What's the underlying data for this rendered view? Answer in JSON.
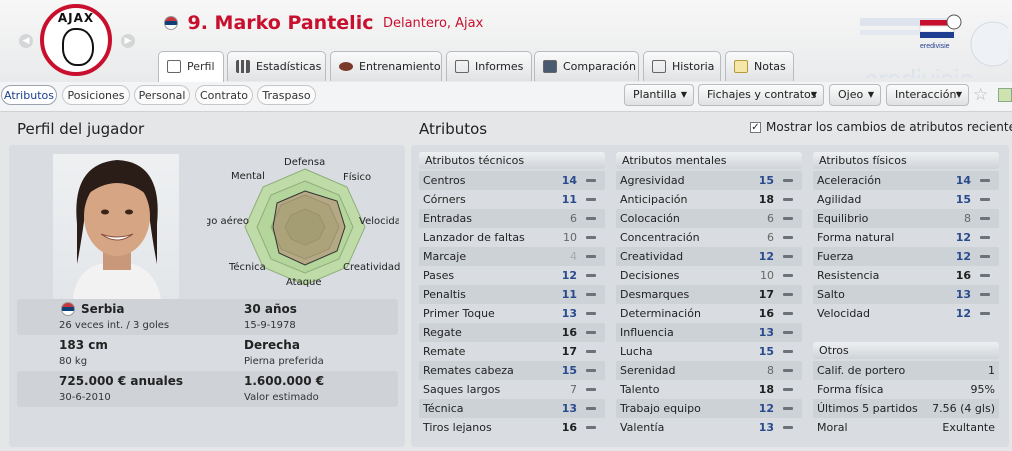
{
  "header": {
    "club_logo_text": "AJAX",
    "player_title": "9. Marko Pantelic",
    "player_sub": "Delantero, Ajax",
    "league_logo_text": "eredivisie"
  },
  "tabs": [
    {
      "label": "Perfil",
      "icon": "profile-icon"
    },
    {
      "label": "Estadísticas",
      "icon": "stats-icon"
    },
    {
      "label": "Entrenamiento",
      "icon": "training-icon"
    },
    {
      "label": "Informes",
      "icon": "reports-icon"
    },
    {
      "label": "Comparación",
      "icon": "compare-icon"
    },
    {
      "label": "Historia",
      "icon": "history-icon"
    },
    {
      "label": "Notas",
      "icon": "notes-icon"
    }
  ],
  "subtabs": [
    "Atributos",
    "Posiciones",
    "Personal",
    "Contrato",
    "Traspaso"
  ],
  "dropdowns": [
    "Plantilla",
    "Fichajes y contratos",
    "Ojeo",
    "Interacción"
  ],
  "profile": {
    "title": "Perfil del jugador",
    "radar_labels": {
      "defensa": "Defensa",
      "fisico": "Físico",
      "velocidad": "Velocidad",
      "creatividad": "Creatividad",
      "ataque": "Ataque",
      "tecnica": "Técnica",
      "juego_aereo": "Juego aéreo",
      "mental": "Mental"
    },
    "info": {
      "nation": "Serbia",
      "caps": "26 veces int. / 3 goles",
      "age": "30 años",
      "dob": "15-9-1978",
      "height": "183 cm",
      "weight": "80 kg",
      "foot": "Derecha",
      "foot_label": "Pierna preferida",
      "wage": "725.000 € anuales",
      "contract_end": "30-6-2010",
      "value": "1.600.000 €",
      "value_label": "Valor estimado"
    }
  },
  "attributes": {
    "title": "Atributos",
    "show_changes_label": "Mostrar los cambios de atributos recientes",
    "show_changes_checked": true,
    "technical": {
      "header": "Atributos técnicos",
      "rows": [
        {
          "name": "Centros",
          "value": "14"
        },
        {
          "name": "Córners",
          "value": "11"
        },
        {
          "name": "Entradas",
          "value": "6"
        },
        {
          "name": "Lanzador de faltas",
          "value": "10"
        },
        {
          "name": "Marcaje",
          "value": "4"
        },
        {
          "name": "Pases",
          "value": "12"
        },
        {
          "name": "Penaltis",
          "value": "11"
        },
        {
          "name": "Primer Toque",
          "value": "13"
        },
        {
          "name": "Regate",
          "value": "16"
        },
        {
          "name": "Remate",
          "value": "17"
        },
        {
          "name": "Remates cabeza",
          "value": "15"
        },
        {
          "name": "Saques largos",
          "value": "7"
        },
        {
          "name": "Técnica",
          "value": "13"
        },
        {
          "name": "Tiros lejanos",
          "value": "16"
        }
      ]
    },
    "mental": {
      "header": "Atributos mentales",
      "rows": [
        {
          "name": "Agresividad",
          "value": "15"
        },
        {
          "name": "Anticipación",
          "value": "18"
        },
        {
          "name": "Colocación",
          "value": "6"
        },
        {
          "name": "Concentración",
          "value": "6"
        },
        {
          "name": "Creatividad",
          "value": "12"
        },
        {
          "name": "Decisiones",
          "value": "10"
        },
        {
          "name": "Desmarques",
          "value": "17"
        },
        {
          "name": "Determinación",
          "value": "16"
        },
        {
          "name": "Influencia",
          "value": "13"
        },
        {
          "name": "Lucha",
          "value": "15"
        },
        {
          "name": "Serenidad",
          "value": "8"
        },
        {
          "name": "Talento",
          "value": "18"
        },
        {
          "name": "Trabajo equipo",
          "value": "12"
        },
        {
          "name": "Valentía",
          "value": "13"
        }
      ]
    },
    "physical": {
      "header": "Atributos físicos",
      "rows": [
        {
          "name": "Aceleración",
          "value": "14"
        },
        {
          "name": "Agilidad",
          "value": "15"
        },
        {
          "name": "Equilibrio",
          "value": "8"
        },
        {
          "name": "Forma natural",
          "value": "12"
        },
        {
          "name": "Fuerza",
          "value": "12"
        },
        {
          "name": "Resistencia",
          "value": "16"
        },
        {
          "name": "Salto",
          "value": "13"
        },
        {
          "name": "Velocidad",
          "value": "12"
        }
      ]
    },
    "otros": {
      "header": "Otros",
      "rows": [
        {
          "name": "Calif. de portero",
          "value": "1"
        },
        {
          "name": "Forma física",
          "value": "95%"
        },
        {
          "name": "Últimos 5 partidos",
          "value": "7.56 (4 gls)"
        },
        {
          "name": "Moral",
          "value": "Exultante"
        }
      ]
    }
  }
}
